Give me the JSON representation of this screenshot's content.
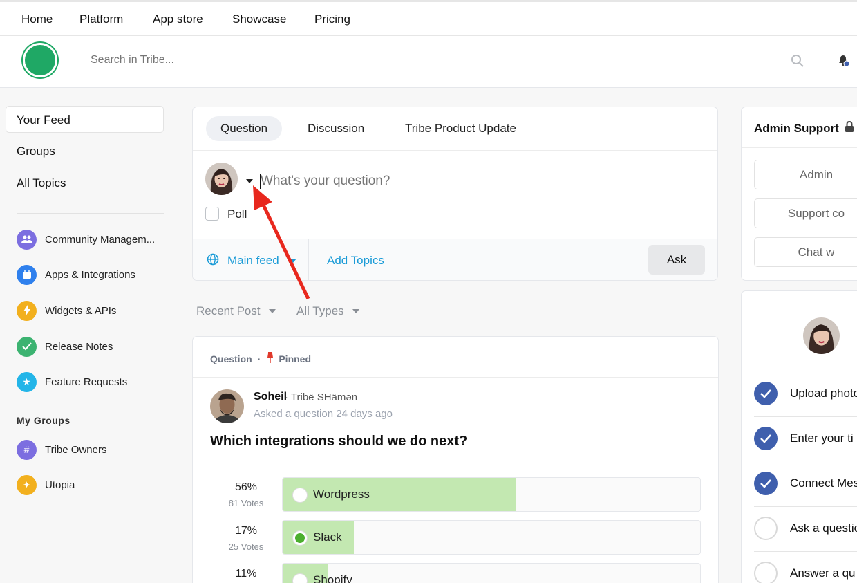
{
  "nav": {
    "items": [
      "Home",
      "Platform",
      "App store",
      "Showcase",
      "Pricing"
    ]
  },
  "header": {
    "search_placeholder": "Search in Tribe..."
  },
  "sidebar": {
    "main": [
      "Your Feed",
      "Groups",
      "All Topics"
    ],
    "topics": [
      {
        "label": "Community Managem...",
        "icon": "people-icon",
        "color": "#7c6ee0"
      },
      {
        "label": "Apps & Integrations",
        "icon": "app-icon",
        "color": "#2f80ed"
      },
      {
        "label": "Widgets & APIs",
        "icon": "lightning-icon",
        "color": "#f2b01e"
      },
      {
        "label": "Release Notes",
        "icon": "check-icon",
        "color": "#3cb371"
      },
      {
        "label": "Feature Requests",
        "icon": "star-icon",
        "color": "#23b5e8"
      }
    ],
    "groups_heading": "My Groups",
    "groups": [
      {
        "label": "Tribe Owners",
        "icon": "hash-icon",
        "color": "#7c6ee0"
      },
      {
        "label": "Utopia",
        "icon": "sparkle-icon",
        "color": "#f2b01e"
      }
    ]
  },
  "composer": {
    "tabs": [
      "Question",
      "Discussion",
      "Tribe Product Update"
    ],
    "active_tab": "Question",
    "placeholder": "What's your question?",
    "poll_label": "Poll",
    "feed_label": "Main feed",
    "add_topics": "Add Topics",
    "ask_label": "Ask"
  },
  "filters": {
    "sort": "Recent Post",
    "type": "All Types"
  },
  "post": {
    "type_label": "Question",
    "pinned_label": "Pinned",
    "author": "Soheil",
    "author_role": "Tribë SHämən",
    "asked": "Asked a question 24 days ago",
    "title": "Which integrations should we do next?",
    "options": [
      {
        "pct": "56%",
        "votes": "81 Votes",
        "label": "Wordpress",
        "fill": 0.56,
        "selected": false
      },
      {
        "pct": "17%",
        "votes": "25 Votes",
        "label": "Slack",
        "fill": 0.17,
        "selected": true
      },
      {
        "pct": "11%",
        "votes": "",
        "label": "Shopify",
        "fill": 0.11,
        "selected": false
      }
    ]
  },
  "admin": {
    "title": "Admin Support",
    "buttons": [
      "Admin",
      "Support co",
      "Chat w"
    ]
  },
  "onboarding": {
    "steps": [
      {
        "label": "Upload photo",
        "done": true
      },
      {
        "label": "Enter your ti",
        "done": true
      },
      {
        "label": "Connect Mes",
        "done": true
      },
      {
        "label": "Ask a questio",
        "done": false
      },
      {
        "label": "Answer a qu",
        "done": false
      }
    ]
  }
}
